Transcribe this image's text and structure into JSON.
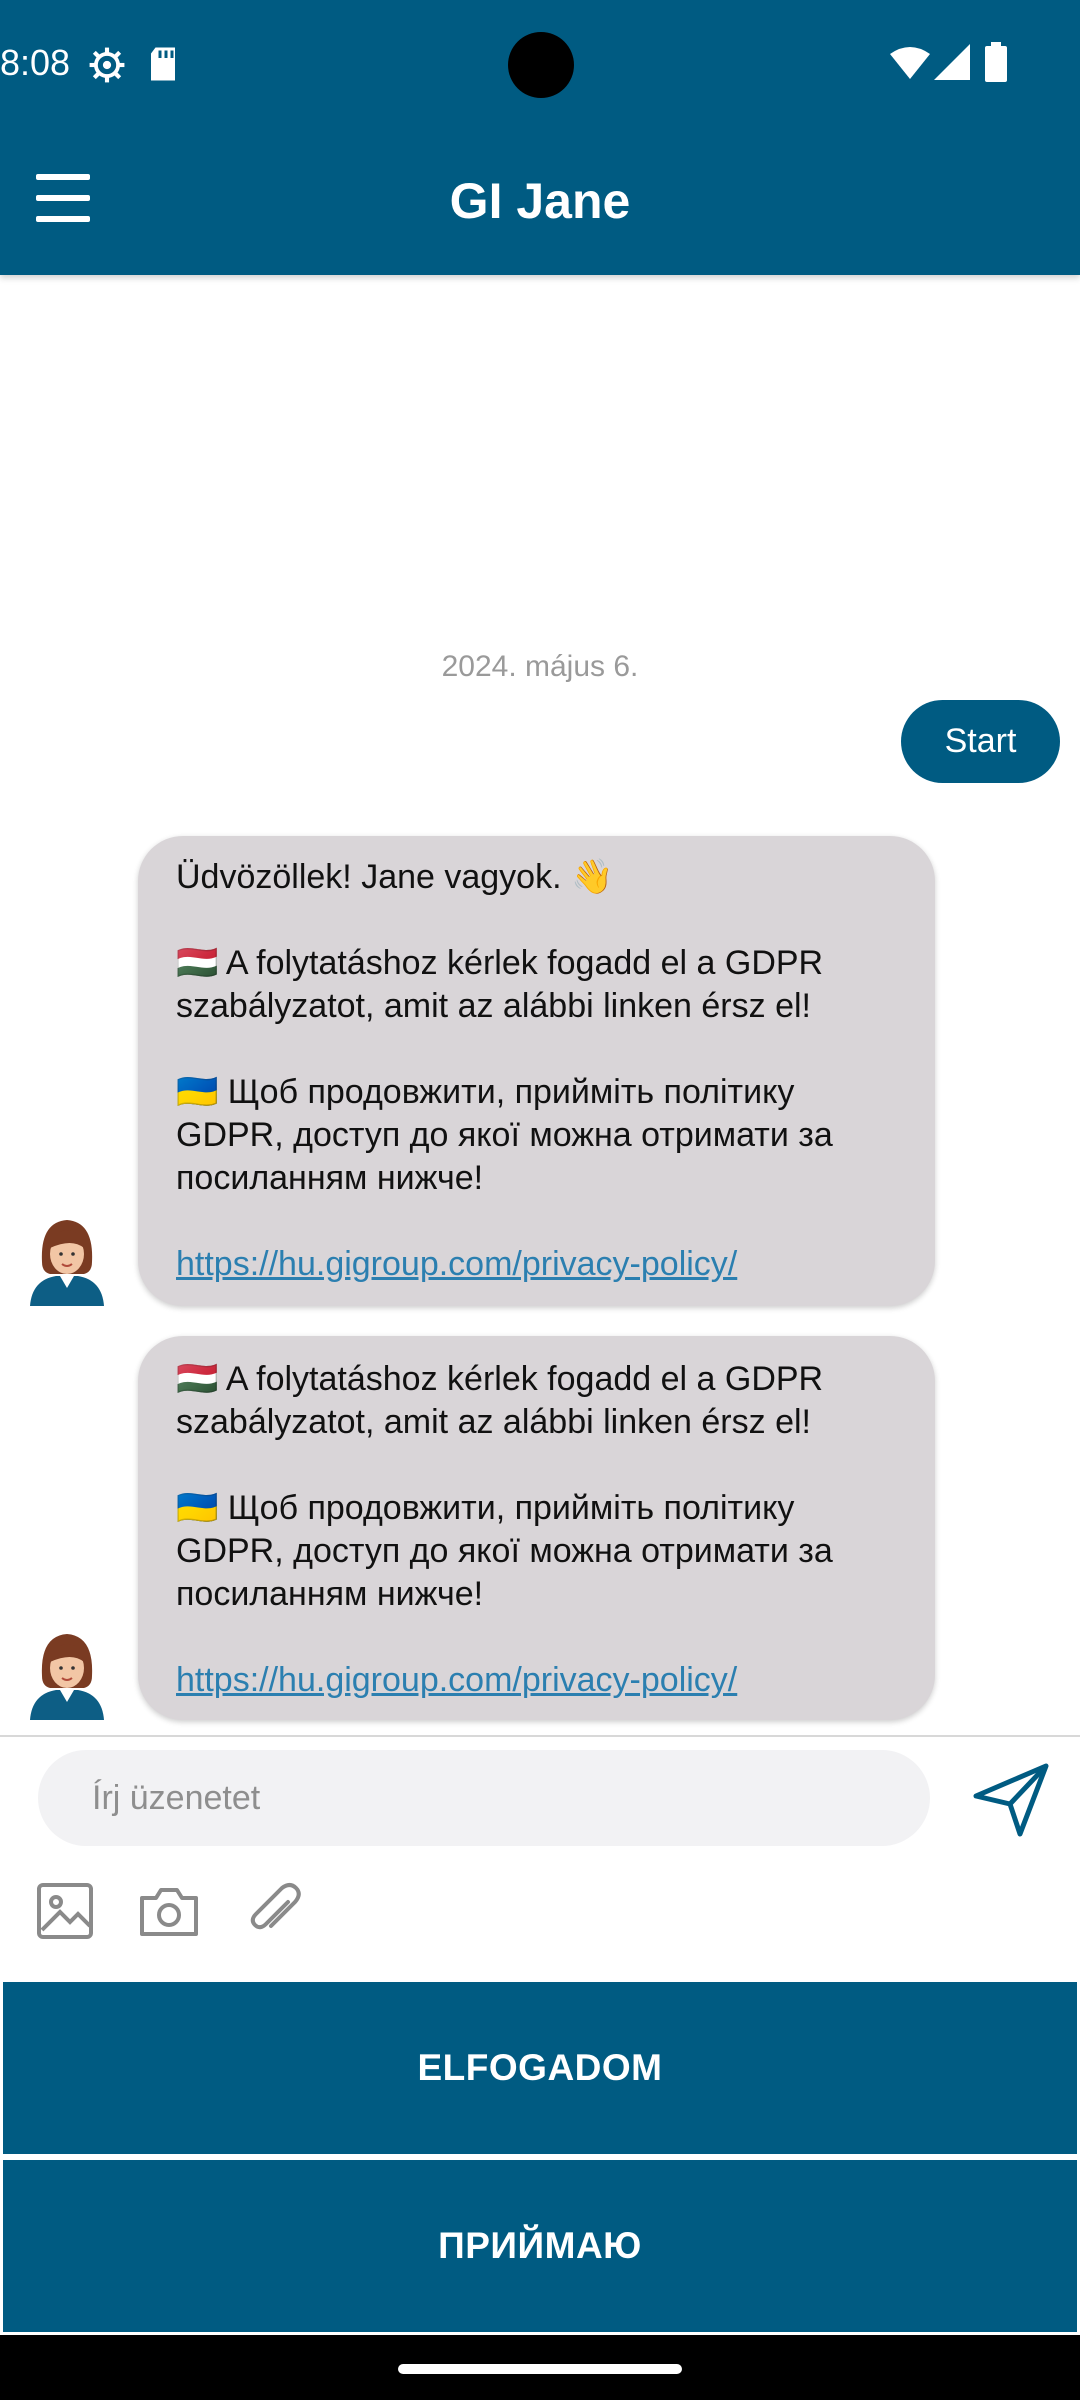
{
  "status_bar": {
    "time": "8:08",
    "icons": [
      "settings-icon",
      "sd-card-icon",
      "wifi-icon",
      "signal-icon",
      "battery-icon"
    ]
  },
  "app_bar": {
    "title": "GI Jane",
    "menu_icon": "hamburger-menu-icon"
  },
  "chat": {
    "date": "2024. május 6.",
    "user_message": "Start",
    "bot_messages": [
      {
        "lines": [
          "Üdvözöllek! Jane vagyok. 👋",
          "🇭🇺 A folytatáshoz kérlek fogadd el a GDPR",
          "szabályzatot, amit az alábbi linken érsz el!",
          "🇺🇦 Щоб продовжити, прийміть політику",
          "GDPR, доступ до якої можна отримати за",
          "посиланням нижче!"
        ],
        "link": "https://hu.gigroup.com/privacy-policy/"
      },
      {
        "lines": [
          "🇭🇺 A folytatáshoz kérlek fogadd el a GDPR",
          "szabályzatot, amit az alábbi linken érsz el!",
          "🇺🇦 Щоб продовжити, прийміть політику",
          "GDPR, доступ до якої можна отримати за",
          "посиланням нижче!"
        ],
        "link": "https://hu.gigroup.com/privacy-policy/"
      }
    ]
  },
  "composer": {
    "placeholder": "Írj üzenetet",
    "tools": [
      "image-icon",
      "camera-icon",
      "paperclip-icon"
    ],
    "send_icon": "send-icon"
  },
  "quick_replies": {
    "accept_hu": "ELFOGADOM",
    "accept_ua": "ПРИЙМАЮ"
  },
  "colors": {
    "primary": "#005b82",
    "bot_bubble": "#d9d5d8",
    "link": "#2b7fb0"
  }
}
